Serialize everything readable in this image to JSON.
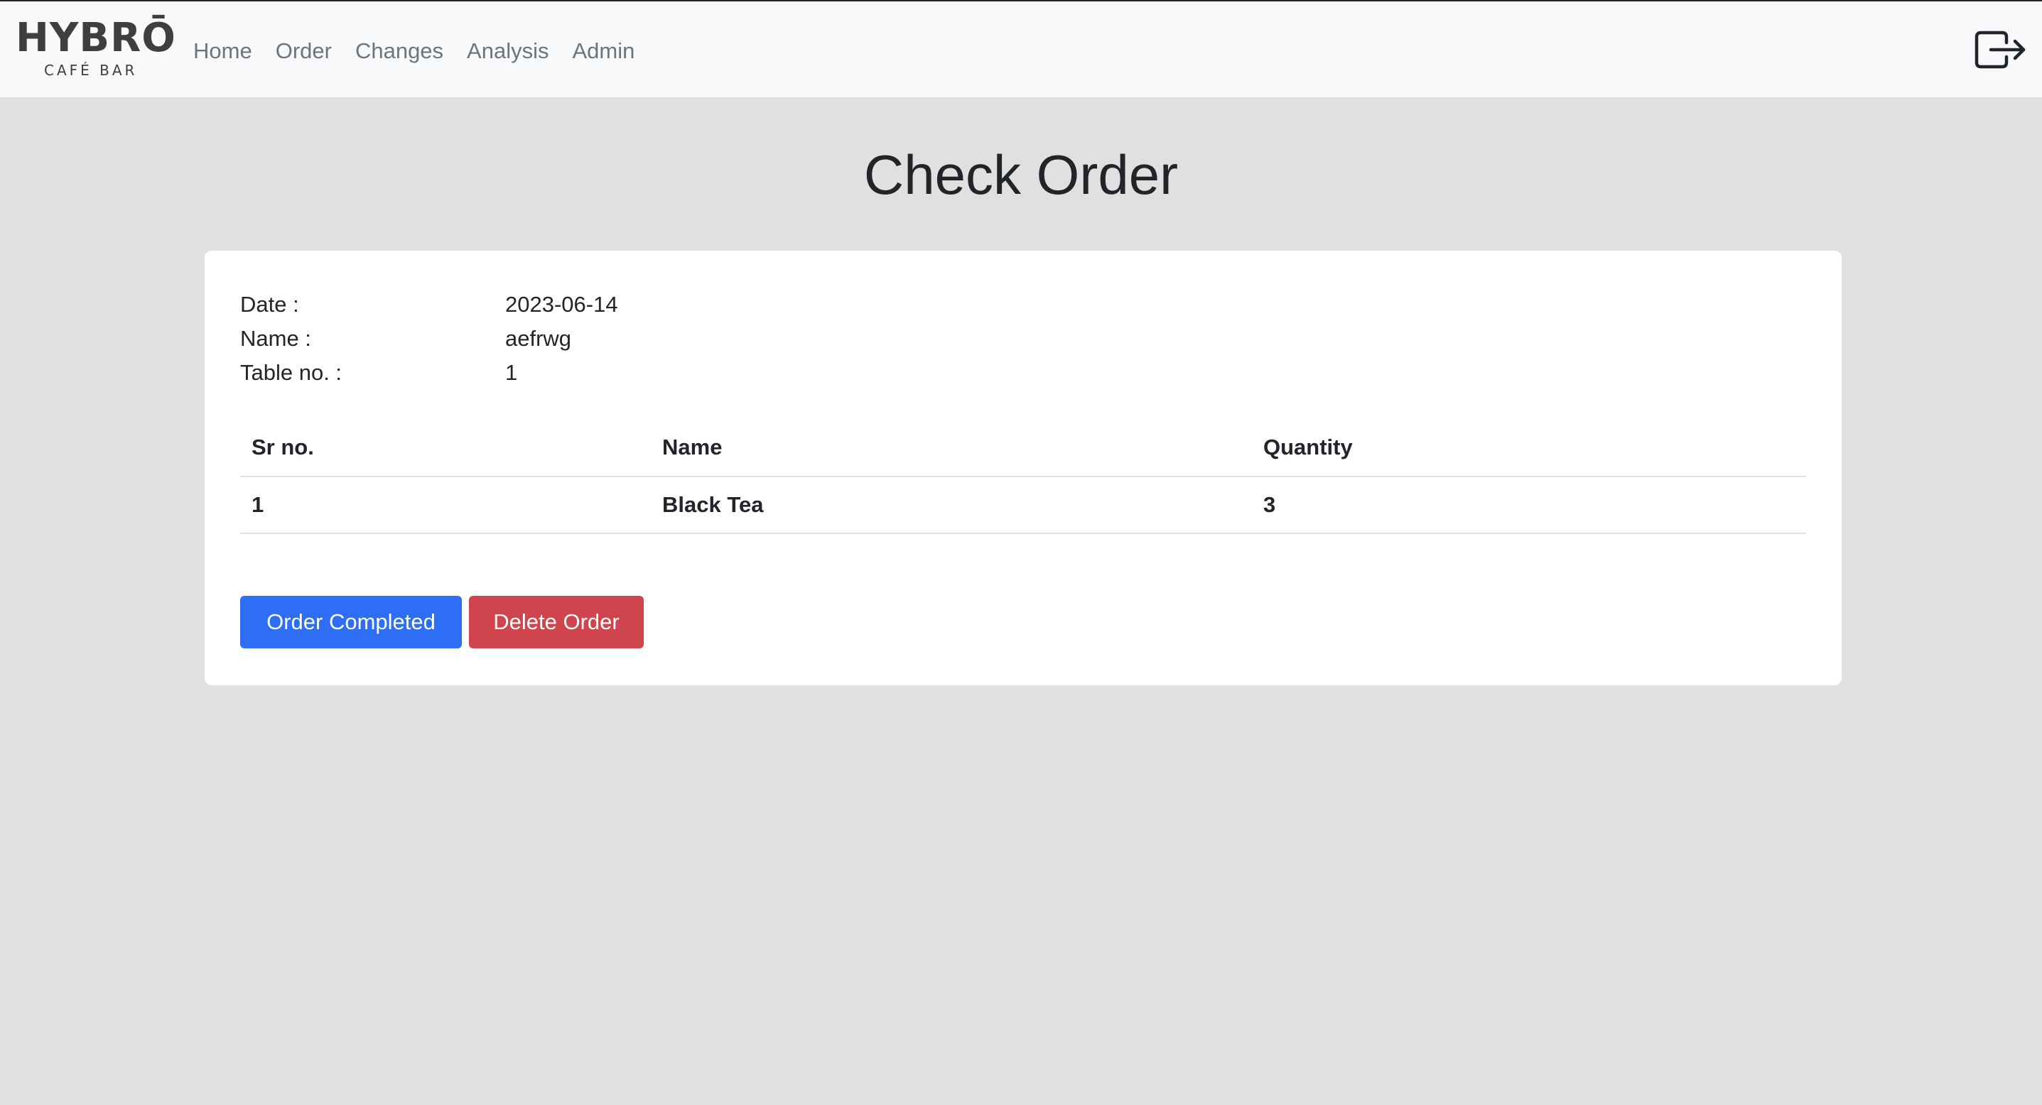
{
  "brand": {
    "name": "HYBRŌ",
    "tagline": "CAFÉ BAR"
  },
  "nav": {
    "items": [
      {
        "label": "Home"
      },
      {
        "label": "Order"
      },
      {
        "label": "Changes"
      },
      {
        "label": "Analysis"
      },
      {
        "label": "Admin"
      }
    ],
    "logout_icon": "logout-icon"
  },
  "page": {
    "title": "Check Order"
  },
  "order": {
    "date_label": "Date :",
    "date_value": "2023-06-14",
    "name_label": "Name :",
    "name_value": "aefrwg",
    "table_label": "Table no. :",
    "table_value": "1"
  },
  "items_table": {
    "headers": [
      "Sr no.",
      "Name",
      "Quantity"
    ],
    "rows": [
      [
        "1",
        "Black Tea",
        "3"
      ]
    ]
  },
  "actions": {
    "complete_label": "Order Completed",
    "delete_label": "Delete Order"
  },
  "colors": {
    "primary": "#2e6ef5",
    "danger": "#d0444d",
    "background": "#e0e0e0",
    "navbar": "#f8f9fa"
  }
}
